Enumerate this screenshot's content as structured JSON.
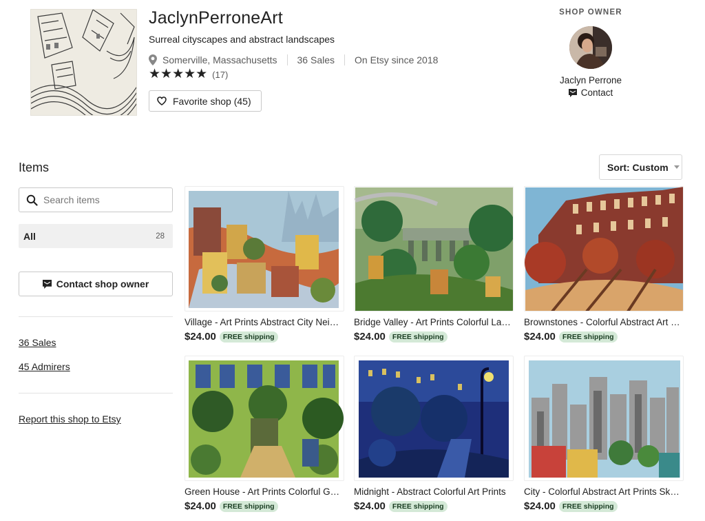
{
  "shop": {
    "name": "JaclynPerroneArt",
    "tagline": "Surreal cityscapes and abstract landscapes",
    "location": "Somerville, Massachusetts",
    "sales": "36 Sales",
    "since": "On Etsy since 2018",
    "stars": "★★★★★",
    "rating_count": "(17)",
    "favorite_label": "Favorite shop (45)"
  },
  "owner": {
    "label": "SHOP OWNER",
    "name": "Jaclyn Perrone",
    "contact_label": "Contact"
  },
  "sidebar": {
    "title": "Items",
    "search_placeholder": "Search items",
    "category_all": "All",
    "category_all_count": "28",
    "contact_button": "Contact shop owner",
    "sales_link": "36 Sales",
    "admirers_link": "45 Admirers",
    "report_link": "Report this shop to Etsy"
  },
  "sort": {
    "label": "Sort: Custom"
  },
  "listings": [
    {
      "title": "Village - Art Prints Abstract City Neighborhood",
      "price": "$24.00",
      "shipping": "FREE shipping"
    },
    {
      "title": "Bridge Valley - Art Prints Colorful Landscape",
      "price": "$24.00",
      "shipping": "FREE shipping"
    },
    {
      "title": "Brownstones - Colorful Abstract Art Prints",
      "price": "$24.00",
      "shipping": "FREE shipping"
    },
    {
      "title": "Green House - Art Prints Colorful Garden",
      "price": "$24.00",
      "shipping": "FREE shipping"
    },
    {
      "title": "Midnight - Abstract Colorful Art Prints",
      "price": "$24.00",
      "shipping": "FREE shipping"
    },
    {
      "title": "City - Colorful Abstract Art Prints Skyline",
      "price": "$24.00",
      "shipping": "FREE shipping"
    }
  ],
  "colors": {
    "free_shipping_bg": "#d4e9d7",
    "selected_category_bg": "#f0f0f0"
  },
  "icons": {
    "location": "map-pin-icon",
    "favorite": "heart-icon",
    "contact": "message-icon",
    "search": "search-icon",
    "sort": "caret-down-icon"
  }
}
